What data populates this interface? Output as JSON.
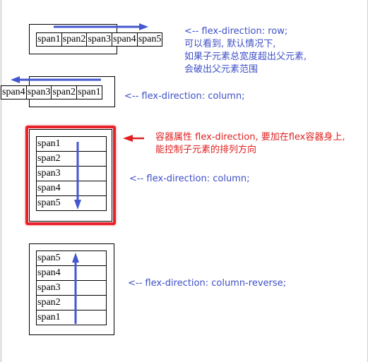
{
  "colors": {
    "arrow_blue": "#4457cf",
    "annotation_blue": "#3e4fc6",
    "annotation_red": "#e02020",
    "frame_red": "#e8212a"
  },
  "example_row": {
    "spans": [
      "span1",
      "span2",
      "span3",
      "span4",
      "span5"
    ],
    "note_lines": [
      "<-- flex-direction: row;",
      "可以看到, 默认情况下,",
      "如果子元素总宽度超出父元素,",
      "会破出父元素范围"
    ]
  },
  "example_row_reverse": {
    "spans": [
      "span4",
      "span3",
      "span2",
      "span1"
    ],
    "note": "<-- flex-direction: column;"
  },
  "example_column": {
    "spans": [
      "span1",
      "span2",
      "span3",
      "span4",
      "span5"
    ],
    "callout_lines": [
      "容器属性 flex-direction, 要加在flex容器身上,",
      "能控制子元素的排列方向"
    ],
    "note": "<-- flex-direction: column;"
  },
  "example_column_reverse": {
    "spans": [
      "span5",
      "span4",
      "span3",
      "span2",
      "span1"
    ],
    "note": "<-- flex-direction: column-reverse;"
  }
}
